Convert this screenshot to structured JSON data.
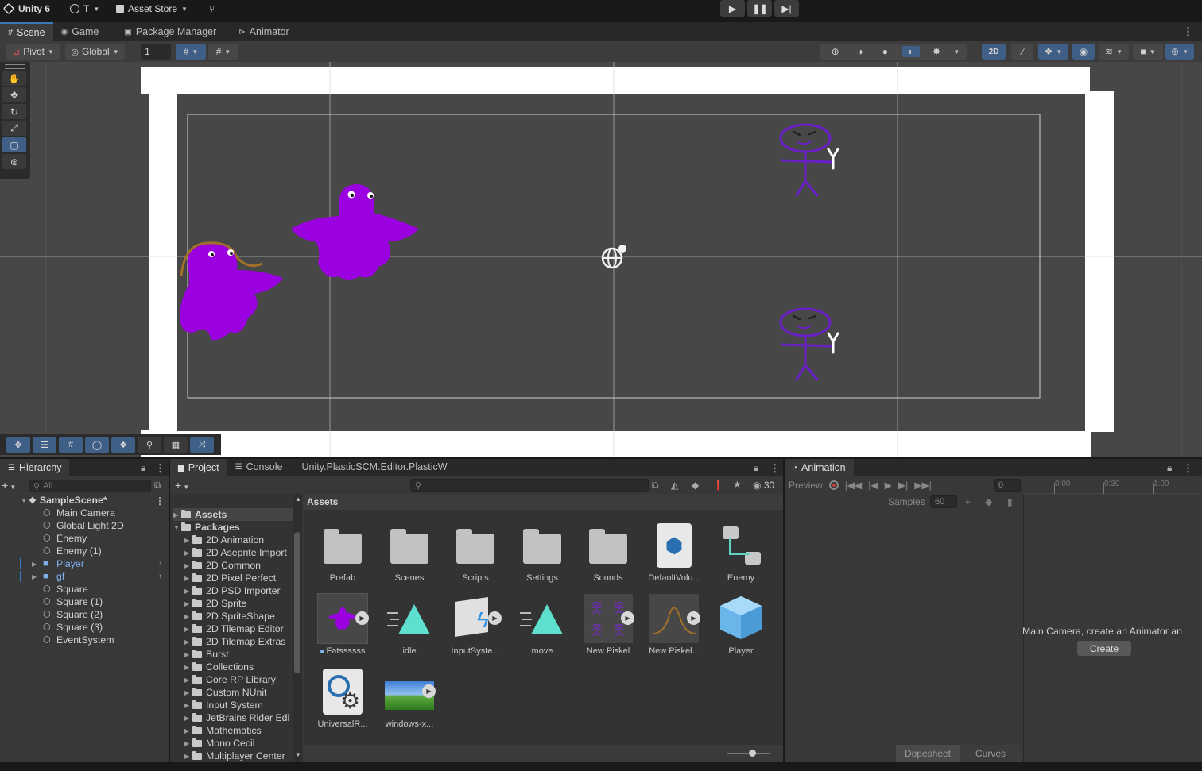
{
  "topbar": {
    "app_title": "Unity 6",
    "account_label": "T",
    "asset_store_label": "Asset Store"
  },
  "scene_tabs": [
    {
      "label": "Scene",
      "icon": "grid-icon"
    },
    {
      "label": "Game",
      "icon": "gamepad-icon"
    },
    {
      "label": "Package Manager",
      "icon": "package-icon"
    },
    {
      "label": "Animator",
      "icon": "animator-icon"
    }
  ],
  "scene_toolbar": {
    "pivot_label": "Pivot",
    "global_label": "Global",
    "grid_snap_value": "1",
    "mode_2d_label": "2D"
  },
  "hierarchy": {
    "tab_label": "Hierarchy",
    "search_placeholder": "All",
    "scene_name": "SampleScene*",
    "items": [
      {
        "label": "Main Camera",
        "type": "object"
      },
      {
        "label": "Global Light 2D",
        "type": "object"
      },
      {
        "label": "Enemy",
        "type": "object"
      },
      {
        "label": "Enemy (1)",
        "type": "object"
      },
      {
        "label": "Player",
        "type": "prefab"
      },
      {
        "label": "gf",
        "type": "prefab"
      },
      {
        "label": "Square",
        "type": "object"
      },
      {
        "label": "Square (1)",
        "type": "object"
      },
      {
        "label": "Square (2)",
        "type": "object"
      },
      {
        "label": "Square (3)",
        "type": "object"
      },
      {
        "label": "EventSystem",
        "type": "object"
      }
    ]
  },
  "project": {
    "tabs": [
      "Project",
      "Console",
      "Unity.PlasticSCM.Editor.PlasticW"
    ],
    "hidden_count": "30",
    "breadcrumb": "Assets",
    "tree_roots": [
      "Assets",
      "Packages"
    ],
    "packages": [
      "2D Animation",
      "2D Aseprite Import",
      "2D Common",
      "2D Pixel Perfect",
      "2D PSD Importer",
      "2D Sprite",
      "2D SpriteShape",
      "2D Tilemap Editor",
      "2D Tilemap Extras",
      "Burst",
      "Collections",
      "Core RP Library",
      "Custom NUnit",
      "Input System",
      "JetBrains Rider Edi",
      "Mathematics",
      "Mono Cecil",
      "Multiplayer Center"
    ],
    "assets": [
      {
        "label": "Prefab",
        "kind": "folder"
      },
      {
        "label": "Scenes",
        "kind": "folder"
      },
      {
        "label": "Scripts",
        "kind": "folder"
      },
      {
        "label": "Settings",
        "kind": "folder"
      },
      {
        "label": "Sounds",
        "kind": "folder"
      },
      {
        "label": "DefaultVolu...",
        "kind": "volume"
      },
      {
        "label": "Enemy",
        "kind": "controller"
      },
      {
        "label": "Fatssssss",
        "kind": "sprite"
      },
      {
        "label": "idle",
        "kind": "anim"
      },
      {
        "label": "InputSyste...",
        "kind": "inputactions"
      },
      {
        "label": "move",
        "kind": "anim"
      },
      {
        "label": "New Piskel",
        "kind": "sheet"
      },
      {
        "label": "New Piskel...",
        "kind": "curve"
      },
      {
        "label": "Player",
        "kind": "prefab"
      },
      {
        "label": "UniversalR...",
        "kind": "urp"
      },
      {
        "label": "windows-x...",
        "kind": "image"
      }
    ]
  },
  "animation": {
    "tab_label": "Animation",
    "preview_label": "Preview",
    "frame_value": "0",
    "samples_label": "Samples",
    "samples_value": "60",
    "timeline_ticks": [
      "0:00",
      "0:30",
      "1:00"
    ],
    "message": "Main Camera, create an Animator an",
    "create_label": "Create",
    "dopesheet_label": "Dopesheet",
    "curves_label": "Curves"
  },
  "colors": {
    "accent_blue": "#3a79bb",
    "purple_character": "#9a00e0",
    "prefab_blue": "#7fb0ee"
  }
}
